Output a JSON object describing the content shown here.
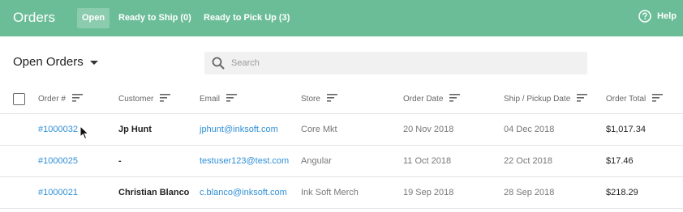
{
  "header": {
    "title": "Orders",
    "tabs": [
      {
        "label": "Open",
        "active": true
      },
      {
        "label": "Ready to Ship (0)",
        "active": false
      },
      {
        "label": "Ready to Pick Up (3)",
        "active": false
      }
    ],
    "help_label": "Help",
    "help_icon": "help-circle-icon"
  },
  "toolbar": {
    "view_label": "Open Orders",
    "view_icon": "caret-down-icon",
    "search_placeholder": "Search",
    "search_icon": "search-icon"
  },
  "table": {
    "columns": [
      "Order #",
      "Customer",
      "Email",
      "Store",
      "Order Date",
      "Ship / Pickup Date",
      "Order Total"
    ],
    "sort_icon": "sort-icon",
    "rows": [
      {
        "order": "#1000032",
        "customer": "Jp Hunt",
        "email": "jphunt@inksoft.com",
        "store": "Core Mkt",
        "order_date": "20 Nov 2018",
        "ship_date": "04 Dec 2018",
        "total": "$1,017.34"
      },
      {
        "order": "#1000025",
        "customer": "-",
        "email": "testuser123@test.com",
        "store": "Angular",
        "order_date": "11 Oct 2018",
        "ship_date": "22 Oct 2018",
        "total": "$17.46"
      },
      {
        "order": "#1000021",
        "customer": "Christian Blanco",
        "email": "c.blanco@inksoft.com",
        "store": "Ink Soft Merch",
        "order_date": "19 Sep 2018",
        "ship_date": "28 Sep 2018",
        "total": "$218.29"
      }
    ]
  },
  "colors": {
    "header_bg": "#6bbd98",
    "link": "#2f8fd6",
    "search_bg": "#f1f1f1"
  }
}
